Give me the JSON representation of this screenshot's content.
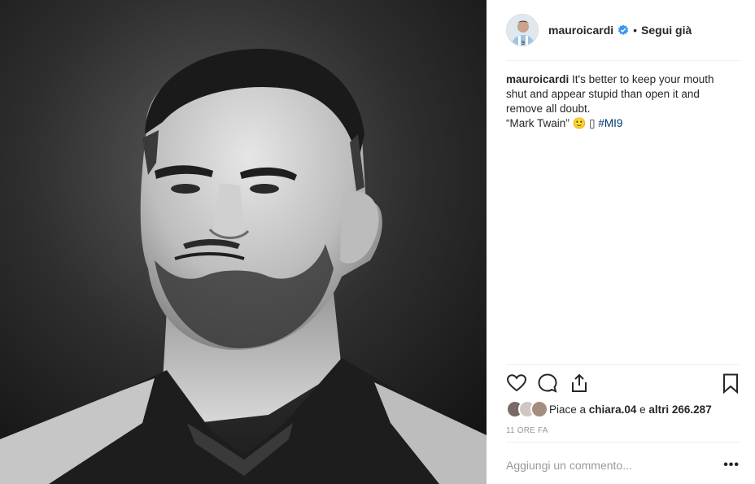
{
  "post": {
    "image_alt": "Black and white portrait photo",
    "header": {
      "username": "mauroicardi",
      "follow_separator": "•",
      "follow_label": "Segui già"
    },
    "caption": {
      "username": "mauroicardi",
      "text": "It's better to keep your mouth shut and appear stupid than open it and remove all doubt.",
      "quote_line": "“Mark Twain”",
      "emoji": "🙂",
      "unknown_glyph": "▯",
      "hashtag": "#MI9"
    },
    "actions": {
      "like_icon": "heart-icon",
      "comment_icon": "comment-icon",
      "share_icon": "share-icon",
      "save_icon": "bookmark-icon"
    },
    "likes": {
      "prefix": "Piace a",
      "liker": "chiara.04",
      "middle": "e",
      "others": "altri 266.287"
    },
    "timestamp": "11 ORE FA",
    "comment": {
      "placeholder": "Aggiungi un commento...",
      "more_label": "•••"
    }
  },
  "colors": {
    "verified_blue": "#3897f0",
    "hashtag_blue": "#003569",
    "text": "#262626",
    "muted": "#999999",
    "divider": "#efefef"
  }
}
